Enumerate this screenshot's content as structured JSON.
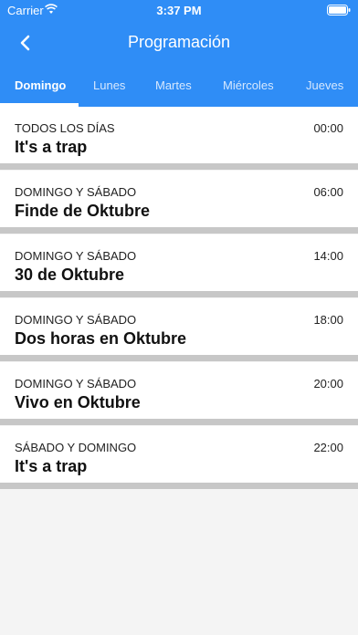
{
  "status_bar": {
    "carrier": "Carrier",
    "time": "3:37 PM"
  },
  "nav": {
    "title": "Programación",
    "back_icon": "chevron-left-icon"
  },
  "tabs": [
    {
      "label": "Domingo",
      "active": true
    },
    {
      "label": "Lunes",
      "active": false
    },
    {
      "label": "Martes",
      "active": false
    },
    {
      "label": "Miércoles",
      "active": false
    },
    {
      "label": "Jueves",
      "active": false
    }
  ],
  "schedule": [
    {
      "days": "TODOS LOS DÍAS",
      "time": "00:00",
      "title": "It's a trap"
    },
    {
      "days": "DOMINGO Y SÁBADO",
      "time": "06:00",
      "title": "Finde de Oktubre"
    },
    {
      "days": "DOMINGO Y SÁBADO",
      "time": "14:00",
      "title": "30 de Oktubre"
    },
    {
      "days": "DOMINGO Y SÁBADO",
      "time": "18:00",
      "title": "Dos horas en Oktubre"
    },
    {
      "days": "DOMINGO Y SÁBADO",
      "time": "20:00",
      "title": "Vivo en Oktubre"
    },
    {
      "days": "SÁBADO Y DOMINGO",
      "time": "22:00",
      "title": "It's a trap"
    }
  ],
  "colors": {
    "header": "#2f8df6",
    "separator": "#c7c7c7",
    "background": "#f4f4f4"
  }
}
